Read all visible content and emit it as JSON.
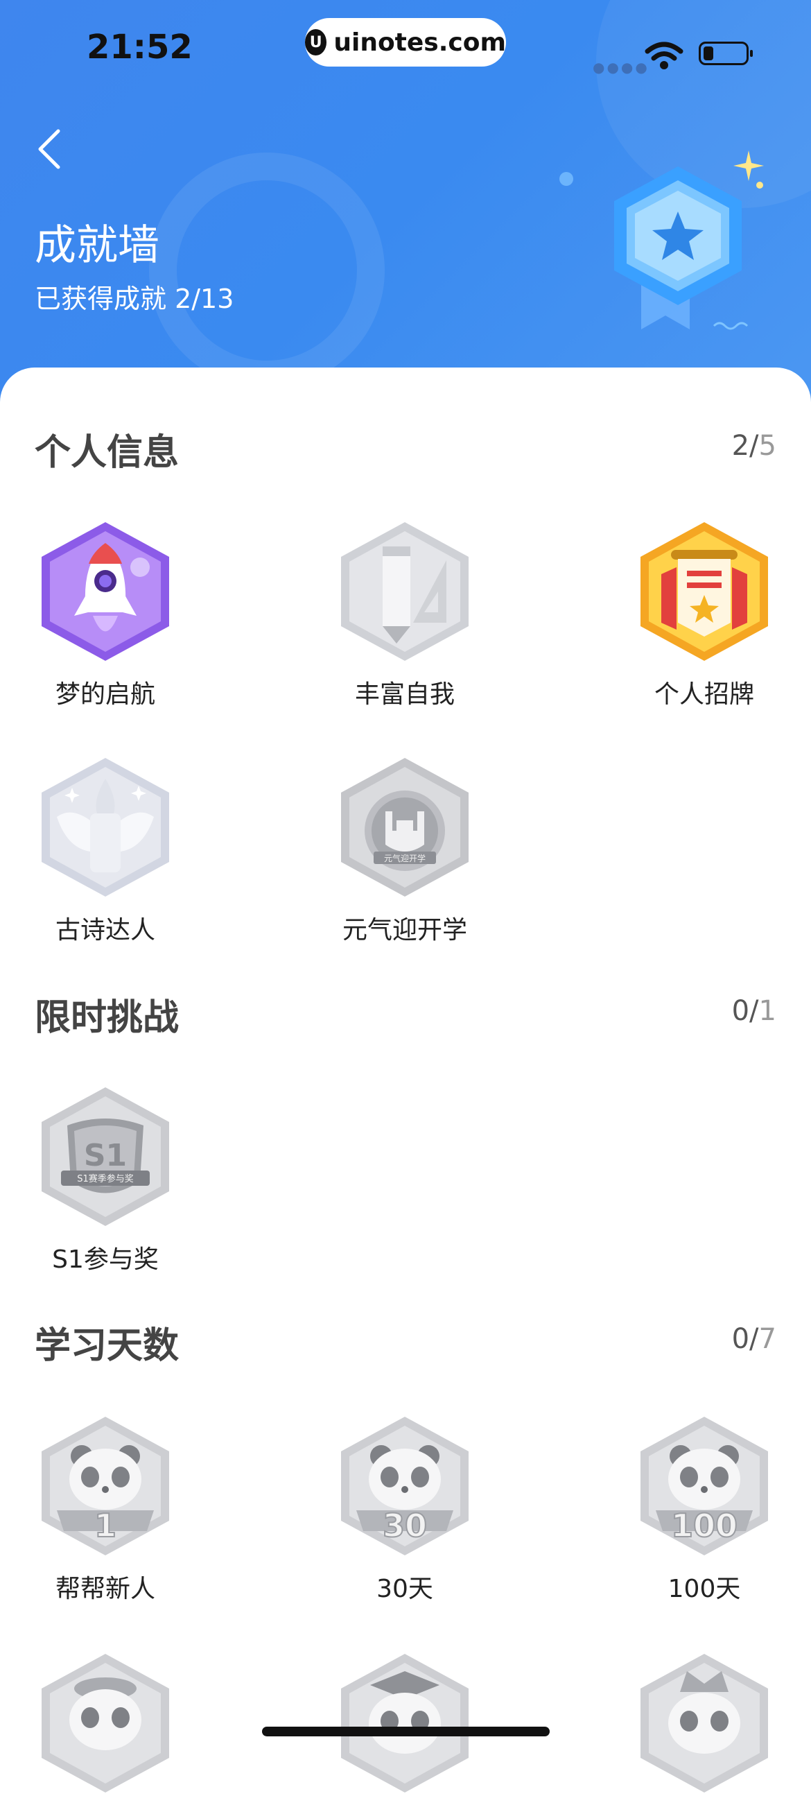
{
  "status_bar": {
    "time": "21:52",
    "url": "uinotes.com"
  },
  "header": {
    "title": "成就墙",
    "subtitle": "已获得成就 2/13"
  },
  "sections": [
    {
      "title": "个人信息",
      "earned": "2/",
      "total": "5",
      "items": [
        {
          "label": "梦的启航",
          "icon": "rocket-icon",
          "earned": true,
          "color": "#9b6cf0"
        },
        {
          "label": "丰富自我",
          "icon": "pencil-ruler-icon",
          "earned": false
        },
        {
          "label": "个人招牌",
          "icon": "banner-icon",
          "earned": true,
          "color": "#f7b324"
        },
        {
          "label": "古诗达人",
          "icon": "winged-brush-icon",
          "earned": false
        },
        {
          "label": "元气迎开学",
          "icon": "rock-hand-icon",
          "earned": false
        }
      ]
    },
    {
      "title": "限时挑战",
      "earned": "0/",
      "total": "1",
      "items": [
        {
          "label": "S1参与奖",
          "icon": "s1-medal-icon",
          "earned": false
        }
      ]
    },
    {
      "title": "学习天数",
      "earned": "0/",
      "total": "7",
      "items": [
        {
          "label": "帮帮新人",
          "icon": "panda-1-icon",
          "earned": false,
          "number": "1"
        },
        {
          "label": "30天",
          "icon": "panda-30-icon",
          "earned": false,
          "number": "30"
        },
        {
          "label": "100天",
          "icon": "panda-100-icon",
          "earned": false,
          "number": "100"
        },
        {
          "label": "",
          "icon": "panda-beret-icon",
          "earned": false
        },
        {
          "label": "",
          "icon": "panda-graduate-icon",
          "earned": false
        },
        {
          "label": "",
          "icon": "panda-crown-icon",
          "earned": false
        }
      ]
    }
  ],
  "colors": {
    "header_blue": "#3f86ee",
    "locked_gray": "#d7d8dc"
  }
}
